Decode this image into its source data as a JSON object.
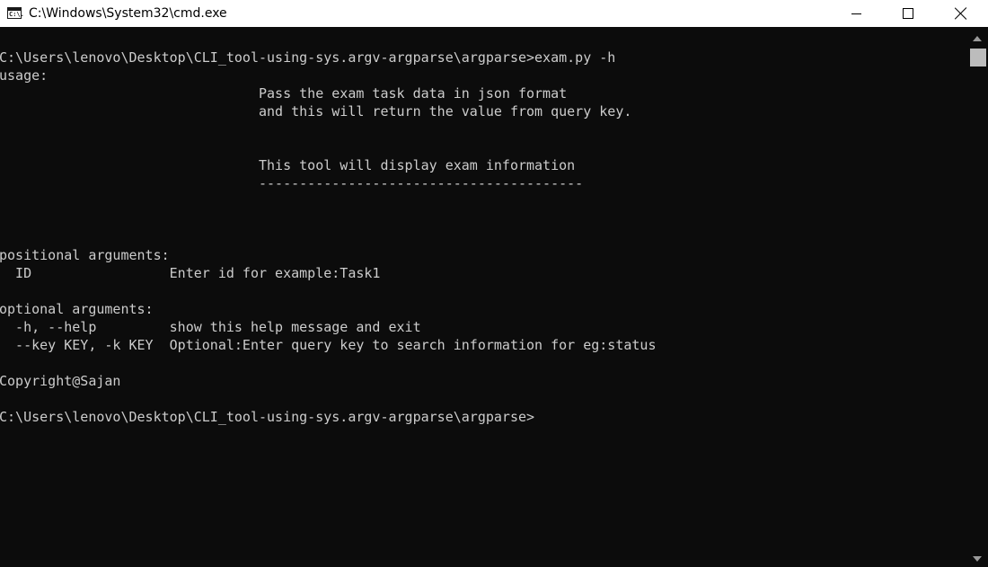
{
  "window": {
    "title": "C:\\Windows\\System32\\cmd.exe",
    "icon": "cmd-icon",
    "icon_glyph": "C:\\."
  },
  "colors": {
    "console_bg": "#0c0c0c",
    "console_fg": "#cccccc",
    "titlebar_bg": "#ffffff"
  },
  "console": {
    "lines": [
      "C:\\Users\\lenovo\\Desktop\\CLI_tool-using-sys.argv-argparse\\argparse>exam.py -h",
      "usage:",
      "                                Pass the exam task data in json format",
      "                                and this will return the value from query key.",
      "",
      "",
      "                                This tool will display exam information",
      "                                ----------------------------------------",
      "",
      "",
      "",
      "positional arguments:",
      "  ID                 Enter id for example:Task1",
      "",
      "optional arguments:",
      "  -h, --help         show this help message and exit",
      "  --key KEY, -k KEY  Optional:Enter query key to search information for eg:status",
      "",
      "Copyright@Sajan",
      "",
      "C:\\Users\\lenovo\\Desktop\\CLI_tool-using-sys.argv-argparse\\argparse>"
    ]
  }
}
